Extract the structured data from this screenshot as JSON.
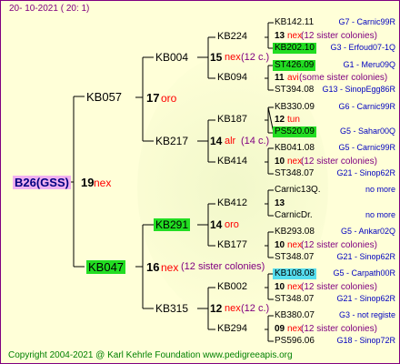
{
  "date": "20- 10-2021 ( 20: 1)",
  "root": {
    "label": "B26(GSS)",
    "gen": "19",
    "mark": "nex"
  },
  "gen2": [
    {
      "label": "KB057",
      "num": "17",
      "mark": "oro"
    },
    {
      "label": "KB047",
      "num": "16",
      "mark": "nex",
      "note": "(12 sister colonies)"
    }
  ],
  "gen3": [
    {
      "label": "KB004",
      "num": "15",
      "mark": "nex",
      "note": "(12 c.)"
    },
    {
      "label": "KB217",
      "num": "14",
      "mark": "alr",
      "note": "(14 c.)"
    },
    {
      "label": "KB291",
      "num": "14",
      "mark": "oro"
    },
    {
      "label": "KB315",
      "num": "12",
      "mark": "nex",
      "note": "(12 c.)"
    }
  ],
  "gen4": [
    "KB224",
    "KB094",
    "KB187",
    "KB414",
    "KB412",
    "KB177",
    "KB002",
    "KB294"
  ],
  "gen5": [
    {
      "top": "KB142.11",
      "topr": "G7 - Carnic99R",
      "num": "13",
      "mark": "nex",
      "note": "(12 sister colonies)",
      "bot": "KB202.10",
      "botr": "G3 - Erfoud07-1Q"
    },
    {
      "top": "ST426.09",
      "topr": "G1 - Meru09Q",
      "num": "11",
      "mark": "avi",
      "note": "(some sister colonies)",
      "bot": "ST394.08",
      "botr": "G13 - SinopEgg86R"
    },
    {
      "top": "KB330.09",
      "topr": "G6 - Carnic99R",
      "num": "12",
      "mark": "tun",
      "note": "",
      "bot": "PS520.09",
      "botr": "G5 - Sahar00Q"
    },
    {
      "top": "KB041.08",
      "topr": "G5 - Carnic99R",
      "num": "10",
      "mark": "nex",
      "note": "(12 sister colonies)",
      "bot": "ST348.07",
      "botr": "G21 - Sinop62R"
    },
    {
      "top": "Carnic13Q.",
      "topr": "no more",
      "num": "13",
      "mark": "",
      "note": "",
      "bot": "CarnicDr.",
      "botr": "no more"
    },
    {
      "top": "KB293.08",
      "topr": "G5 - Ankar02Q",
      "num": "10",
      "mark": "nex",
      "note": "(12 sister colonies)",
      "bot": "ST348.07",
      "botr": "G21 - Sinop62R"
    },
    {
      "top": "KB108.08",
      "topr": "G5 - Carpath00R",
      "num": "10",
      "mark": "nex",
      "note": "(12 sister colonies)",
      "bot": "ST348.07",
      "botr": "G21 - Sinop62R"
    },
    {
      "top": "KB380.07",
      "topr": "G3 - not registe",
      "num": "09",
      "mark": "nex",
      "note": "(12 sister colonies)",
      "bot": "PS596.06",
      "botr": "G18 - Sinop72R"
    }
  ],
  "footer": "Copyright 2004-2021 @ Karl Kehrle Foundation www.pedigreeapis.org"
}
